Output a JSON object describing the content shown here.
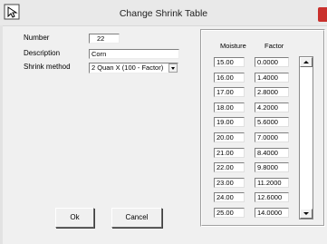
{
  "window": {
    "title": "Change Shrink Table",
    "app_icon": "cursor-app-icon"
  },
  "form": {
    "number_label": "Number",
    "number_value": "22",
    "description_label": "Description",
    "description_value": "Corn",
    "method_label": "Shrink method",
    "method_selected": "2  Quan X (100 - Factor)"
  },
  "buttons": {
    "ok": "Ok",
    "cancel": "Cancel"
  },
  "table": {
    "headers": [
      "Moisture",
      "Factor"
    ],
    "rows": [
      {
        "moisture": "15.00",
        "factor": "0.0000"
      },
      {
        "moisture": "16.00",
        "factor": "1.4000"
      },
      {
        "moisture": "17.00",
        "factor": "2.8000"
      },
      {
        "moisture": "18.00",
        "factor": "4.2000"
      },
      {
        "moisture": "19.00",
        "factor": "5.6000"
      },
      {
        "moisture": "20.00",
        "factor": "7.0000"
      },
      {
        "moisture": "21.00",
        "factor": "8.4000"
      },
      {
        "moisture": "22.00",
        "factor": "9.8000"
      },
      {
        "moisture": "23.00",
        "factor": "11.2000"
      },
      {
        "moisture": "24.00",
        "factor": "12.6000"
      },
      {
        "moisture": "25.00",
        "factor": "14.0000"
      }
    ]
  }
}
